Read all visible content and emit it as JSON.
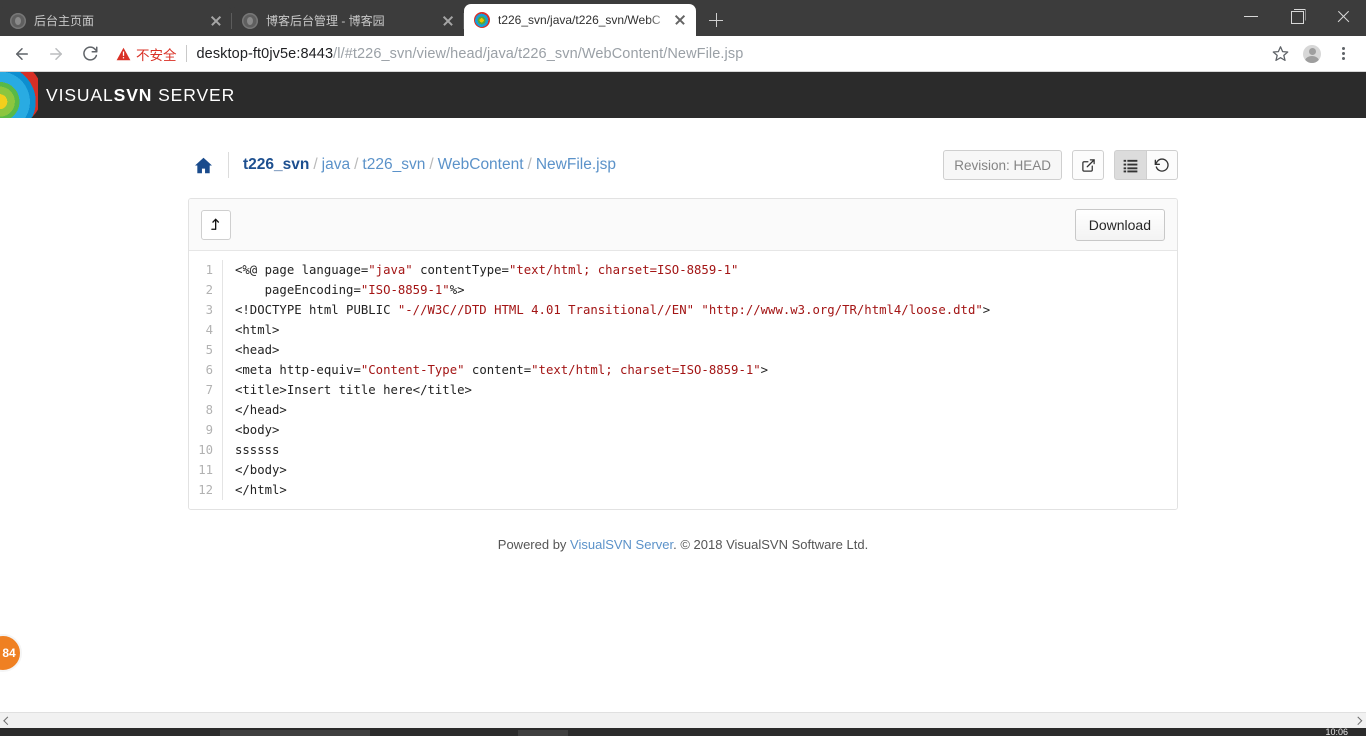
{
  "browser": {
    "tabs": [
      {
        "title": "后台主页面",
        "favicon": "generic-page-icon",
        "active": false
      },
      {
        "title": "博客后台管理 - 博客园",
        "favicon": "generic-page-icon",
        "active": false
      },
      {
        "title": "t226_svn/java/t226_svn/WebC",
        "favicon": "visualsvn-icon",
        "active": true
      }
    ],
    "new_tab_label": "+",
    "window_controls": {
      "minimize": "minimize-icon",
      "maximize": "restore-icon",
      "close": "close-icon"
    },
    "nav": {
      "back": "back-arrow-icon",
      "forward": "forward-arrow-icon",
      "reload": "reload-icon"
    },
    "omnibox": {
      "security_icon": "warning-triangle-icon",
      "security_label": "不安全",
      "url_host": "desktop-ft0jv5e:8443",
      "url_path": "/l/#t226_svn/view/head/java/t226_svn/WebContent/NewFile.jsp",
      "url_full": "desktop-ft0jv5e:8443/l/#t226_svn/view/head/java/t226_svn/WebContent/NewFile.jsp"
    },
    "toolbar_icons": {
      "bookmark": "star-icon",
      "profile": "avatar-icon",
      "menu": "three-dot-menu-icon"
    }
  },
  "app": {
    "brand_prefix": "VISUAL",
    "brand_bold": "SVN",
    "brand_suffix": "SERVER",
    "logo": "visualsvn-rings-logo"
  },
  "breadcrumb": {
    "home_icon": "home-icon",
    "root": "t226_svn",
    "parts": [
      "java",
      "t226_svn",
      "WebContent",
      "NewFile.jsp"
    ],
    "separator": "/"
  },
  "actions": {
    "revision_label": "Revision: HEAD",
    "external_link_icon": "external-link-icon",
    "list_view_icon": "list-view-icon",
    "history_icon": "history-revert-icon"
  },
  "panel": {
    "up_icon": "level-up-arrow-icon",
    "download_label": "Download"
  },
  "file": {
    "name": "NewFile.jsp",
    "lines": [
      {
        "n": "1",
        "parts": [
          {
            "t": "<%@ page language=",
            "c": "plain"
          },
          {
            "t": "\"java\"",
            "c": "string"
          },
          {
            "t": " contentType=",
            "c": "plain"
          },
          {
            "t": "\"text/html; charset=ISO-8859-1\"",
            "c": "string"
          }
        ]
      },
      {
        "n": "2",
        "parts": [
          {
            "t": "    pageEncoding=",
            "c": "plain"
          },
          {
            "t": "\"ISO-8859-1\"",
            "c": "string"
          },
          {
            "t": "%>",
            "c": "plain"
          }
        ]
      },
      {
        "n": "3",
        "parts": [
          {
            "t": "<!DOCTYPE html PUBLIC ",
            "c": "plain"
          },
          {
            "t": "\"-//W3C//DTD HTML 4.01 Transitional//EN\"",
            "c": "string"
          },
          {
            "t": " ",
            "c": "plain"
          },
          {
            "t": "\"http://www.w3.org/TR/html4/loose.dtd\"",
            "c": "string"
          },
          {
            "t": ">",
            "c": "plain"
          }
        ]
      },
      {
        "n": "4",
        "parts": [
          {
            "t": "<html>",
            "c": "plain"
          }
        ]
      },
      {
        "n": "5",
        "parts": [
          {
            "t": "<head>",
            "c": "plain"
          }
        ]
      },
      {
        "n": "6",
        "parts": [
          {
            "t": "<meta http-equiv=",
            "c": "plain"
          },
          {
            "t": "\"Content-Type\"",
            "c": "string"
          },
          {
            "t": " content=",
            "c": "plain"
          },
          {
            "t": "\"text/html; charset=ISO-8859-1\"",
            "c": "string"
          },
          {
            "t": ">",
            "c": "plain"
          }
        ]
      },
      {
        "n": "7",
        "parts": [
          {
            "t": "<title>Insert title here</title>",
            "c": "plain"
          }
        ]
      },
      {
        "n": "8",
        "parts": [
          {
            "t": "</head>",
            "c": "plain"
          }
        ]
      },
      {
        "n": "9",
        "parts": [
          {
            "t": "<body>",
            "c": "plain"
          }
        ]
      },
      {
        "n": "10",
        "parts": [
          {
            "t": "ssssss",
            "c": "plain"
          }
        ]
      },
      {
        "n": "11",
        "parts": [
          {
            "t": "</body>",
            "c": "plain"
          }
        ]
      },
      {
        "n": "12",
        "parts": [
          {
            "t": "</html>",
            "c": "plain"
          }
        ]
      }
    ]
  },
  "footer": {
    "prefix": "Powered by ",
    "link": "VisualSVN Server",
    "suffix": ". © 2018 VisualSVN Software Ltd."
  },
  "overlay_badge": {
    "text": "84"
  },
  "colors": {
    "header_bg": "#2b2b2b",
    "link_blue": "#5b92c9",
    "crumb_root": "#1d4f8f",
    "string_red": "#a31515",
    "badge_orange": "#ef8022",
    "warning_red": "#d93025"
  },
  "taskbar": {
    "time": "10:06"
  }
}
